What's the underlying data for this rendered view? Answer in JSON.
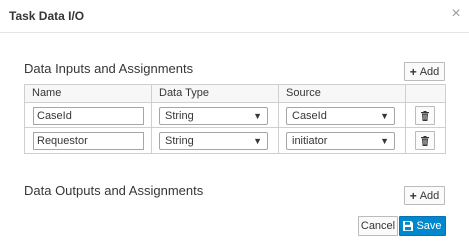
{
  "dialog": {
    "title": "Task Data I/O",
    "close_glyph": "×"
  },
  "inputs": {
    "section_title": "Data Inputs and Assignments",
    "add_label": "Add",
    "columns": [
      "Name",
      "Data Type",
      "Source"
    ],
    "rows": [
      {
        "name": "CaseId",
        "data_type": "String",
        "source": "CaseId"
      },
      {
        "name": "Requestor",
        "data_type": "String",
        "source": "initiator"
      }
    ]
  },
  "outputs": {
    "section_title": "Data Outputs and Assignments",
    "add_label": "Add"
  },
  "footer": {
    "cancel_label": "Cancel",
    "save_label": "Save"
  },
  "icons": {
    "add": "plus-icon",
    "delete": "trash-icon",
    "save": "save-icon",
    "close": "close-icon",
    "dropdown": "caret-down-icon"
  },
  "colors": {
    "primary": "#0088ce",
    "border": "#bbbbbb",
    "text": "#363636"
  }
}
